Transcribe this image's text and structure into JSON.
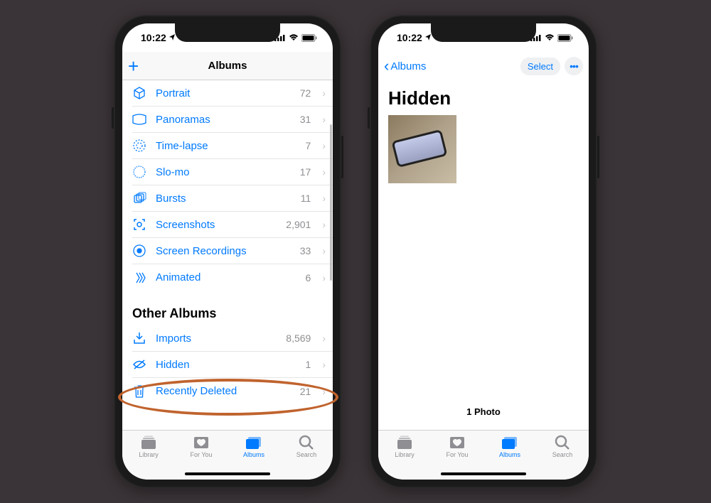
{
  "status": {
    "time": "10:22"
  },
  "colors": {
    "accent": "#007aff",
    "callout": "#c0632e"
  },
  "screenLeft": {
    "title": "Albums",
    "sections": {
      "mediaTypes": [
        {
          "icon": "cube",
          "label": "Portrait",
          "count": "72"
        },
        {
          "icon": "panorama",
          "label": "Panoramas",
          "count": "31"
        },
        {
          "icon": "timelapse",
          "label": "Time-lapse",
          "count": "7"
        },
        {
          "icon": "slomo",
          "label": "Slo-mo",
          "count": "17"
        },
        {
          "icon": "bursts",
          "label": "Bursts",
          "count": "11"
        },
        {
          "icon": "screenshots",
          "label": "Screenshots",
          "count": "2,901"
        },
        {
          "icon": "screenrec",
          "label": "Screen Recordings",
          "count": "33"
        },
        {
          "icon": "animated",
          "label": "Animated",
          "count": "6"
        }
      ],
      "otherHeader": "Other Albums",
      "other": [
        {
          "icon": "imports",
          "label": "Imports",
          "count": "8,569"
        },
        {
          "icon": "hidden",
          "label": "Hidden",
          "count": "1"
        },
        {
          "icon": "trash",
          "label": "Recently Deleted",
          "count": "21"
        }
      ]
    }
  },
  "screenRight": {
    "backLabel": "Albums",
    "selectLabel": "Select",
    "title": "Hidden",
    "footer": "1 Photo"
  },
  "tabs": [
    {
      "id": "library",
      "label": "Library"
    },
    {
      "id": "foryou",
      "label": "For You"
    },
    {
      "id": "albums",
      "label": "Albums"
    },
    {
      "id": "search",
      "label": "Search"
    }
  ],
  "activeTab": "albums"
}
